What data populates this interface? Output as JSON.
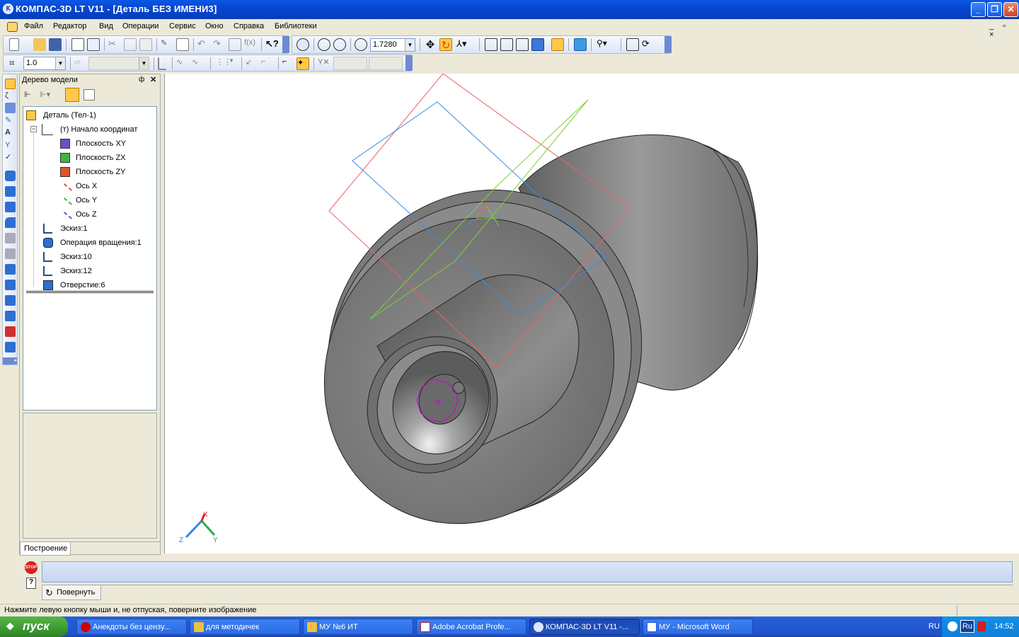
{
  "window": {
    "title": "КОМПАС-3D LT V11 - [Деталь БЕЗ ИМЕНИ3]",
    "app_icon": "К"
  },
  "menu": {
    "items": [
      "Файл",
      "Редактор",
      "Вид",
      "Операции",
      "Сервис",
      "Окно",
      "Справка",
      "Библиотеки"
    ],
    "mdi_controls": "_ ▫ ×"
  },
  "toolbar": {
    "zoom_value": "1.7280",
    "step_value": "1.0"
  },
  "tree": {
    "panel_title": "Дерево модели",
    "pin": "ф",
    "close": "✕",
    "items": [
      {
        "label": "Деталь (Тел-1)",
        "icon": "part-icon"
      },
      {
        "label": "(т) Начало координат",
        "icon": "origin-icon"
      },
      {
        "label": "Плоскость XY",
        "icon": "plane-xy-icon"
      },
      {
        "label": "Плоскость ZX",
        "icon": "plane-zx-icon"
      },
      {
        "label": "Плоскость ZY",
        "icon": "plane-zy-icon"
      },
      {
        "label": "Ось X",
        "icon": "axis-x-icon"
      },
      {
        "label": "Ось Y",
        "icon": "axis-y-icon"
      },
      {
        "label": "Ось Z",
        "icon": "axis-z-icon"
      },
      {
        "label": "Эскиз:1",
        "icon": "sketch-icon"
      },
      {
        "label": "Операция вращения:1",
        "icon": "revolve-icon"
      },
      {
        "label": "Эскиз:10",
        "icon": "sketch-icon"
      },
      {
        "label": "Эскиз:12",
        "icon": "sketch-icon"
      },
      {
        "label": "Отверстие:6",
        "icon": "hole-icon"
      }
    ],
    "tab": "Построение"
  },
  "viewport": {
    "axis_labels": {
      "x": "X",
      "y": "Y",
      "z": "Z"
    }
  },
  "properties": {
    "stop_label": "STOP",
    "help_label": "?",
    "rotate_button": "Повернуть"
  },
  "status": {
    "text": "Нажмите левую кнопку мыши и, не отпуская, поверните изображение"
  },
  "taskbar": {
    "start": "пуск",
    "tasks": [
      {
        "label": "Анекдоты без цензу...",
        "icon": "opera-icon",
        "color": "#d00000"
      },
      {
        "label": "для методичек",
        "icon": "folder-icon",
        "color": "#f0c040"
      },
      {
        "label": "МУ №6 ИТ",
        "icon": "folder-icon",
        "color": "#f0c040"
      },
      {
        "label": "Adobe Acrobat Profe...",
        "icon": "acrobat-icon",
        "color": "#c02020"
      },
      {
        "label": "КОМПАС-3D LT V11 -...",
        "icon": "kompas-icon",
        "color": "#2050c0"
      },
      {
        "label": "МУ - Microsoft Word",
        "icon": "word-icon",
        "color": "#2a5bd7"
      }
    ],
    "lang": "RU",
    "kbd": "Ru",
    "clock": "14:52"
  }
}
